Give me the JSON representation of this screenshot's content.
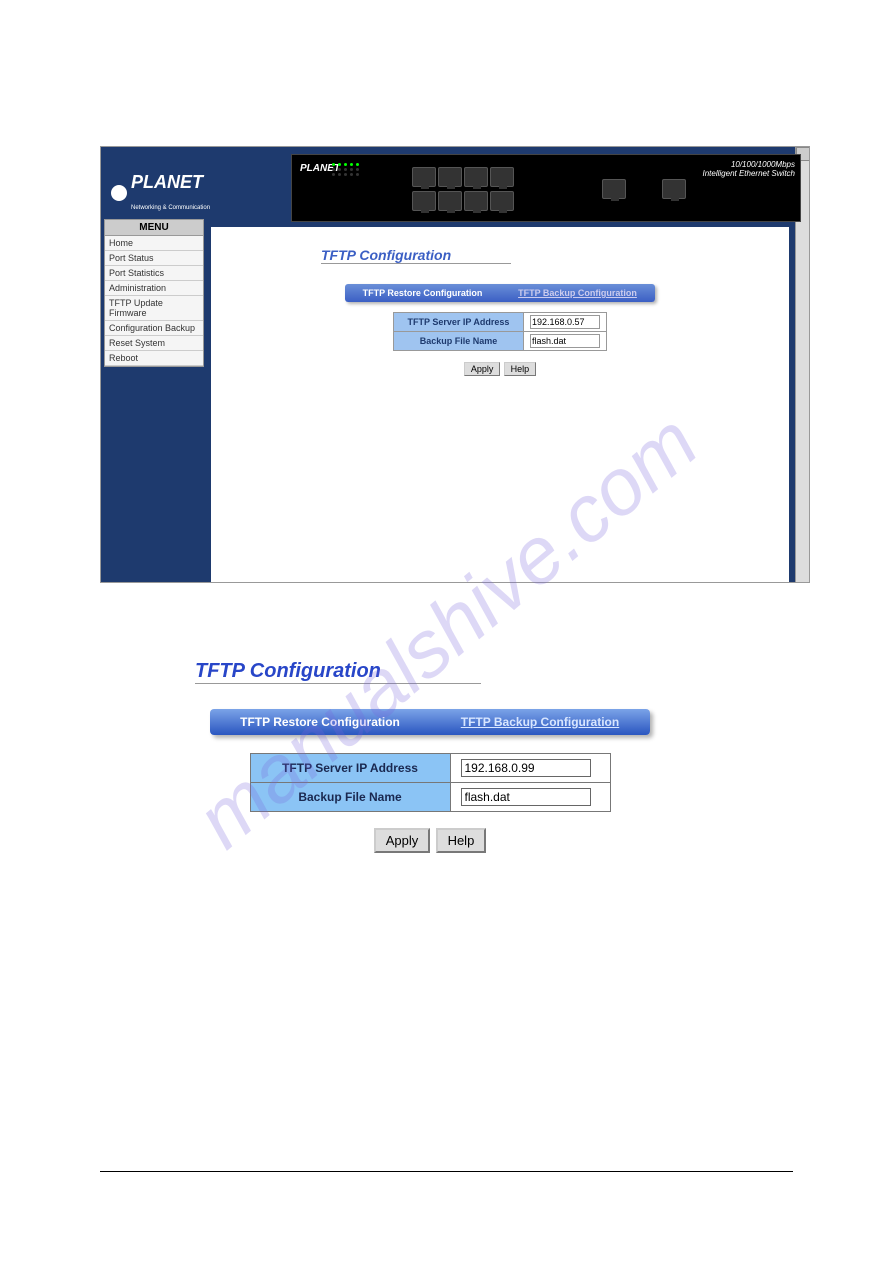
{
  "watermark": "manualshive.com",
  "shot1": {
    "banner": {
      "brand": "PLANET",
      "model_text": "10/100/1000Mbps",
      "model_sub": "Intelligent Ethernet Switch"
    },
    "logo": {
      "brand": "PLANET",
      "tagline": "Networking & Communication"
    },
    "menu": {
      "header": "MENU",
      "items": [
        "Home",
        "Port Status",
        "Port Statistics",
        "Administration",
        "TFTP Update Firmware",
        "Configuration Backup",
        "Reset System",
        "Reboot"
      ]
    },
    "content": {
      "title": "TFTP Configuration",
      "tab_restore": "TFTP Restore Configuration",
      "tab_backup": "TFTP Backup Configuration",
      "row_ip_label": "TFTP Server IP Address",
      "row_ip_value": "192.168.0.57",
      "row_file_label": "Backup File Name",
      "row_file_value": "flash.dat",
      "btn_apply": "Apply",
      "btn_help": "Help"
    }
  },
  "detail": {
    "title": "TFTP Configuration",
    "tab_restore": "TFTP Restore Configuration",
    "tab_backup": "TFTP Backup Configuration",
    "row_ip_label": "TFTP Server IP Address",
    "row_ip_value": "192.168.0.99",
    "row_file_label": "Backup File Name",
    "row_file_value": "flash.dat",
    "btn_apply": "Apply",
    "btn_help": "Help"
  }
}
